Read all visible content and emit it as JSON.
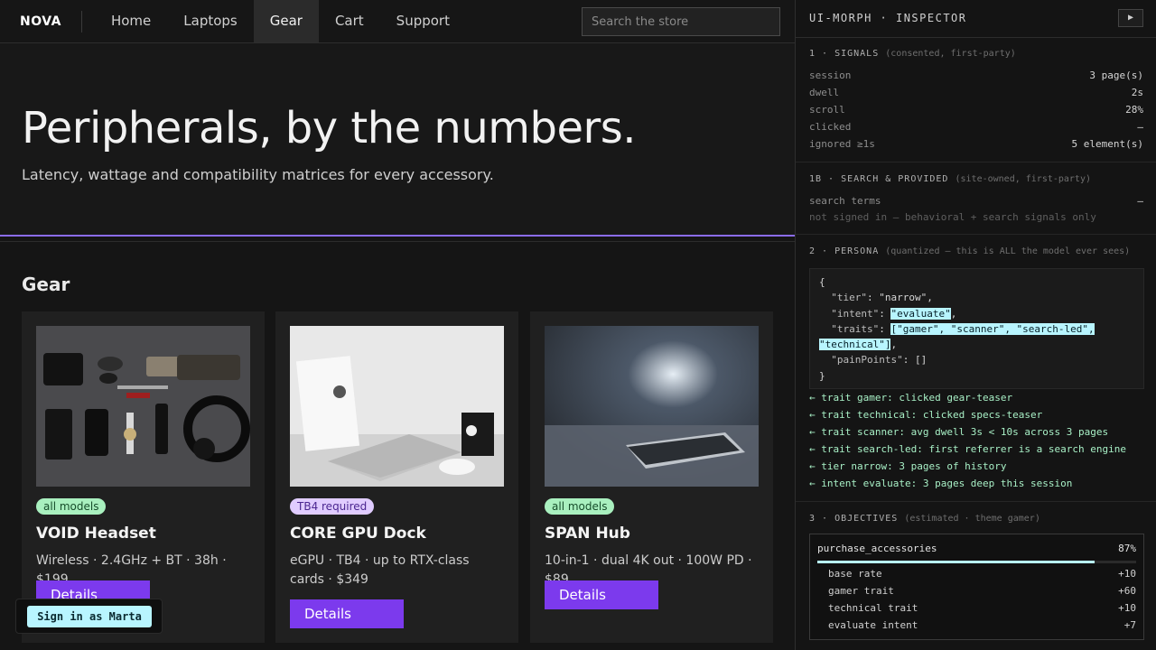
{
  "store": {
    "brand": "NOVA",
    "nav": [
      {
        "label": "Home"
      },
      {
        "label": "Laptops"
      },
      {
        "label": "Gear",
        "active": true
      },
      {
        "label": "Cart"
      },
      {
        "label": "Support"
      }
    ],
    "search_placeholder": "Search the store",
    "hero": {
      "title": "Peripherals, by the numbers.",
      "subtitle": "Latency, wattage and compatibility matrices for every accessory."
    },
    "section_title": "Gear",
    "products": [
      {
        "badge": "all models",
        "name": "VOID Headset",
        "spec": "Wireless · 2.4GHz + BT · 38h · $199",
        "button": "Details"
      },
      {
        "badge": "TB4 required",
        "name": "CORE GPU Dock",
        "spec": "eGPU · TB4 · up to RTX-class cards · $349",
        "button": "Details"
      },
      {
        "badge": "all models",
        "name": "SPAN Hub",
        "spec": "10-in-1 · dual 4K out · 100W PD · $89",
        "button": "Details"
      }
    ],
    "signin_label": "Sign in as Marta"
  },
  "inspector": {
    "title": "UI-MORPH · INSPECTOR",
    "play_icon": "▶",
    "signals": {
      "heading": "1 · SIGNALS",
      "note": "(consented, first-party)",
      "rows": [
        {
          "label": "session",
          "value": "3 page(s)"
        },
        {
          "label": "dwell",
          "value": "2s"
        },
        {
          "label": "scroll",
          "value": "28%"
        },
        {
          "label": "clicked",
          "value": "—"
        },
        {
          "label": "ignored ≥1s",
          "value": "5 element(s)"
        }
      ]
    },
    "search_provided": {
      "heading": "1B · SEARCH & PROVIDED",
      "note": "(site-owned, first-party)",
      "search_terms_label": "search terms",
      "search_terms_value": "—",
      "signed_out_note": "not signed in — behavioral + search signals only"
    },
    "persona": {
      "heading": "2 · PERSONA",
      "note": "(quantized — this is ALL the model ever sees)",
      "json_open": "{",
      "tier_key": "\"tier\"",
      "tier_value": "\"narrow\"",
      "intent_key": "\"intent\"",
      "intent_value": "\"evaluate\"",
      "traits_key": "\"traits\"",
      "traits_value_line1": "[\"gamer\", \"scanner\", \"search-led\",",
      "traits_value_line2": "\"technical\"]",
      "pain_key": "\"painPoints\"",
      "pain_value": "[]",
      "json_close": "}",
      "trace": [
        "← trait gamer: clicked gear-teaser",
        "← trait technical: clicked specs-teaser",
        "← trait scanner: avg dwell 3s < 10s across 3 pages",
        "← trait search-led: first referrer is a search engine",
        "← tier narrow: 3 pages of history",
        "← intent evaluate: 3 pages deep this session"
      ]
    },
    "objectives": {
      "heading": "3 · OBJECTIVES",
      "note": "(estimated · theme gamer)",
      "name": "purchase_accessories",
      "percent_label": "87%",
      "percent": 87,
      "rows": [
        {
          "label": "base rate",
          "value": "+10"
        },
        {
          "label": "gamer trait",
          "value": "+60"
        },
        {
          "label": "technical trait",
          "value": "+10"
        },
        {
          "label": "evaluate intent",
          "value": "+7"
        }
      ]
    }
  },
  "colors": {
    "accent_purple": "#7c3aed",
    "hero_rule": "#8b6cf0",
    "highlight_cyan": "#b8f5ff",
    "trace_green": "#a8f0c6"
  }
}
